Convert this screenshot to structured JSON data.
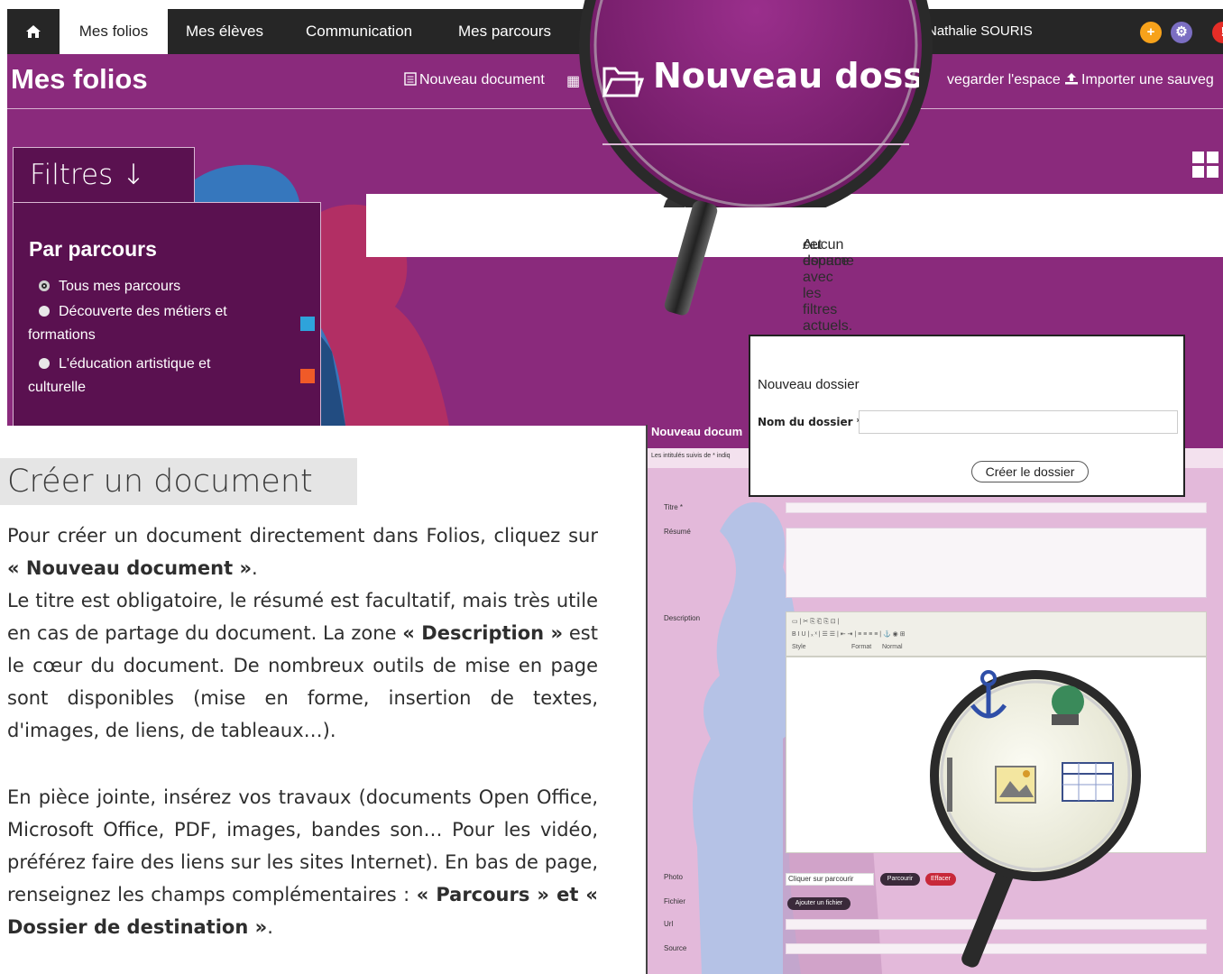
{
  "topnav": {
    "tabs": [
      "Mes folios",
      "Mes élèves",
      "Communication",
      "Mes parcours"
    ],
    "active_tab": "Mes folios",
    "user_name": "Nathalie SOURIS",
    "buttons": [
      "+",
      "⚙",
      "!"
    ]
  },
  "page": {
    "title": "Mes folios",
    "actions": {
      "new_document": "Nouveau document",
      "save_space": "vegarder l'espace",
      "import_backup": "Importer une sauveg"
    },
    "magnified_action": "Nouveau dossier"
  },
  "filters": {
    "tab_label": "Filtres ↓",
    "heading": "Par parcours",
    "options": [
      {
        "label": "Tous mes parcours",
        "selected": true,
        "color": ""
      },
      {
        "label": "Découverte des métiers et formations",
        "selected": false,
        "color": "#2ea3db"
      },
      {
        "label": "L'éducation artistique et culturelle",
        "selected": false,
        "color": "#f05a28"
      }
    ]
  },
  "empty_message": "Aucun document visible dans cet espace avec les filtres actuels.",
  "empty_message_visible": {
    "left": "Aucun docume",
    "right": "cet espace avec les filtres actuels."
  },
  "tutorial": {
    "heading": "Créer un document",
    "p1_a": "Pour créer un document directement dans Folios, cliquez sur ",
    "p1_b": "« Nouveau document »",
    "p1_c": ".",
    "p2_a": "Le titre est obligatoire, le résumé est facultatif, mais très utile en cas de partage du document. La zone ",
    "p2_b": "« Description »",
    "p2_c": " est le cœur du document. De nombreux outils de mise en page sont disponibles (mise en forme, insertion de textes, d'images, de liens, de tableaux…).",
    "p3_a": "En pièce jointe, insérez vos travaux (documents Open Office, Microsoft Office, PDF, images, bandes son… Pour les vidéo, préférez faire des liens sur les sites Internet). En bas de page, renseignez les champs complémentaires : ",
    "p3_b": "« Parcours » et « Dossier de destination »",
    "p3_c": "."
  },
  "form": {
    "header": "Nouveau docum",
    "required_note": "Les intitulés suivis de * indiq",
    "fields": {
      "title": "Titre *",
      "summary": "Résumé",
      "description": "Description",
      "photo": "Photo",
      "file": "Fichier",
      "url": "Url",
      "source": "Source"
    },
    "toolbar": {
      "style": "Style",
      "format": "Format",
      "format_value": "Normal"
    },
    "photo_placeholder": "Cliquer sur parcourir",
    "browse_button": "Parcourir",
    "clear_button": "Effacer",
    "add_file_button": "Ajouter un fichier"
  },
  "dialog": {
    "title": "Nouveau dossier",
    "field_label": "Nom du dossier *",
    "field_value": "",
    "submit": "Créer le dossier"
  },
  "colors": {
    "nav_bg": "#262626",
    "brand_purple": "#8a2a7c",
    "panel_purple": "#5a1150",
    "form_pink": "#e3b9da",
    "accent_orange": "#f7a21b",
    "accent_blue": "#7b6ec2",
    "accent_red": "#e52d27"
  },
  "icons": [
    "home-icon",
    "document-icon",
    "folder-icon",
    "upload-icon",
    "grid-icon",
    "magnifier-icon",
    "anchor-icon",
    "globe-icon",
    "image-icon",
    "table-icon"
  ]
}
